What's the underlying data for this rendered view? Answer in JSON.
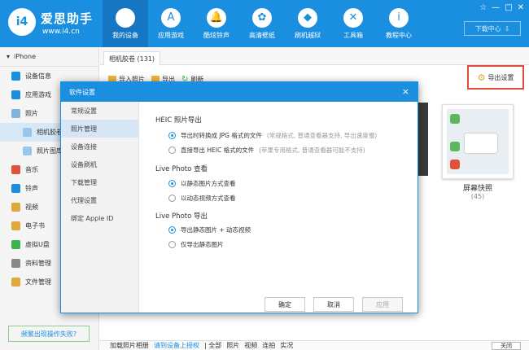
{
  "app": {
    "logo_text": "i4",
    "name": "爱思助手",
    "url": "www.i4.cn"
  },
  "nav": [
    {
      "label": "我的设备",
      "icon": "apple-icon",
      "glyph": "",
      "active": true
    },
    {
      "label": "应用游戏",
      "icon": "app-store-icon",
      "glyph": "A"
    },
    {
      "label": "酷炫铃声",
      "icon": "bell-icon",
      "glyph": "🔔"
    },
    {
      "label": "高清壁纸",
      "icon": "flower-icon",
      "glyph": "✿"
    },
    {
      "label": "刷机越狱",
      "icon": "box-icon",
      "glyph": "◆"
    },
    {
      "label": "工具箱",
      "icon": "tools-icon",
      "glyph": "✕"
    },
    {
      "label": "教程中心",
      "icon": "info-icon",
      "glyph": "i"
    }
  ],
  "window_controls": [
    "☆",
    "—",
    "□",
    "✕"
  ],
  "download": {
    "label": "下载中心",
    "icon": "download-icon"
  },
  "sidebar": {
    "device": "iPhone",
    "items": [
      {
        "label": "设备信息",
        "color": "#1a8fe0"
      },
      {
        "label": "应用游戏",
        "color": "#1a8fe0"
      },
      {
        "label": "照片",
        "color": "#7fb3e0"
      },
      {
        "label": "相机胶卷",
        "color": "#9ac6ec"
      },
      {
        "label": "照片图库",
        "color": "#9ac6ec"
      },
      {
        "label": "音乐",
        "color": "#e0533b"
      },
      {
        "label": "铃声",
        "color": "#1a8fe0"
      },
      {
        "label": "视频",
        "color": "#e0a83b"
      },
      {
        "label": "电子书",
        "color": "#e0a83b"
      },
      {
        "label": "虚拟U盘",
        "color": "#3bb54a"
      },
      {
        "label": "资料管理",
        "color": "#888888"
      },
      {
        "label": "文件管理",
        "color": "#e0a83b"
      }
    ],
    "fail_link": "频繁出现操作失败?"
  },
  "content": {
    "tab": "相机胶卷 (131)",
    "toolbar": {
      "import": "导入照片",
      "export": "导出",
      "refresh": "刷新"
    },
    "export_settings": "导出设置",
    "album": {
      "title": "屏幕快照",
      "count": "(45)"
    },
    "bottom_text": [
      "加载照片相册",
      "请到设备上授权",
      "| 全部",
      "照片",
      "视频",
      "连拍",
      "实况"
    ],
    "bottom_button": "关闭"
  },
  "dialog": {
    "title": "软件设置",
    "close": "×",
    "menu": [
      "常规设置",
      "照片管理",
      "设备连接",
      "设备刷机",
      "下载管理",
      "代理设置",
      "绑定 Apple ID"
    ],
    "active_menu": 1,
    "sections": [
      {
        "title": "HEIC 照片导出",
        "options": [
          {
            "label": "导出时转换成 JPG 格式的文件",
            "hint": "(常规格式, 普通查看器支持, 导出速度慢)",
            "checked": true
          },
          {
            "label": "直接导出 HEIC 格式的文件",
            "hint": "(苹果专用格式, 普通查看器可能不支持)",
            "checked": false
          }
        ]
      },
      {
        "title": "Live Photo 查看",
        "options": [
          {
            "label": "以静态图片方式查看",
            "hint": "",
            "checked": true
          },
          {
            "label": "以动态视频方式查看",
            "hint": "",
            "checked": false
          }
        ]
      },
      {
        "title": "Live Photo 导出",
        "options": [
          {
            "label": "导出静态图片 + 动态视频",
            "hint": "",
            "checked": true
          },
          {
            "label": "仅导出静态图片",
            "hint": "",
            "checked": false
          }
        ]
      }
    ],
    "buttons": {
      "ok": "确定",
      "cancel": "取消",
      "apply": "应用"
    }
  }
}
